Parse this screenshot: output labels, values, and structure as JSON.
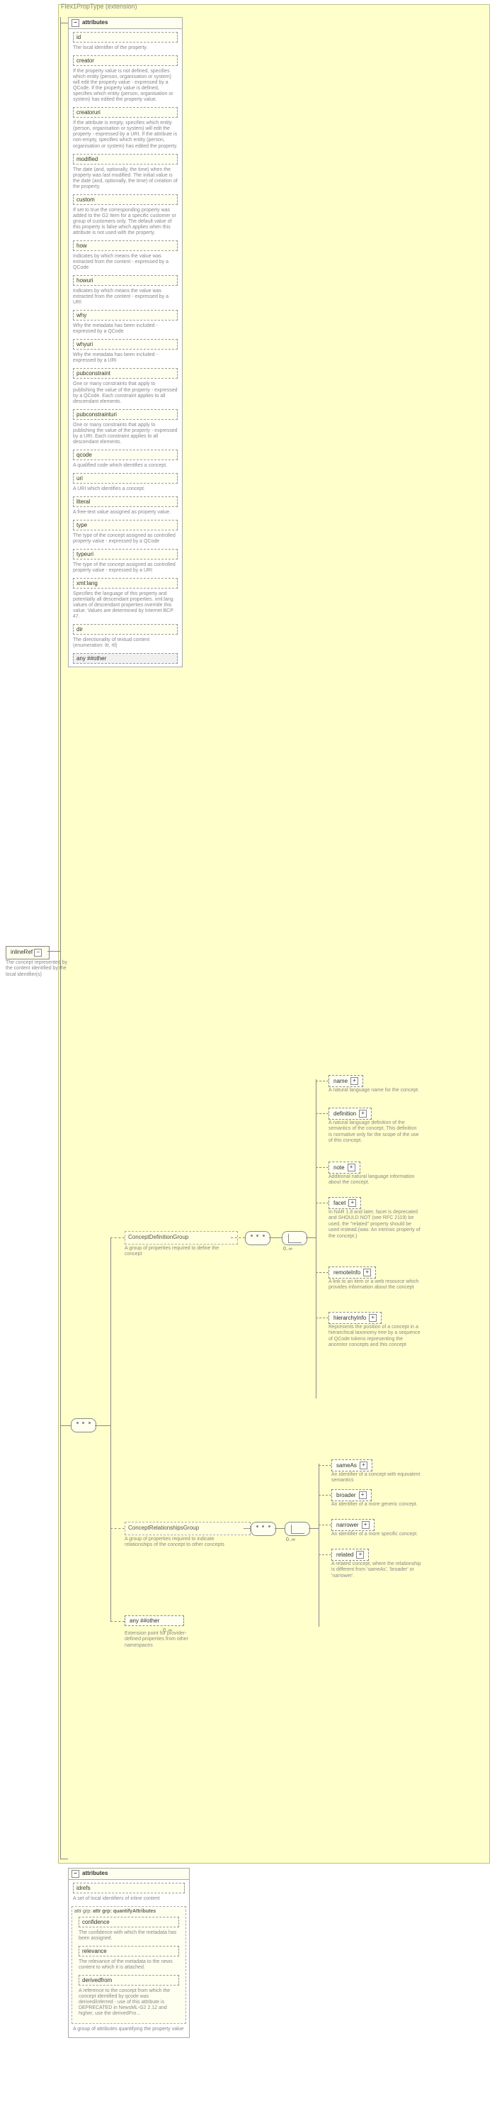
{
  "title": "Flex1PropType (extension)",
  "root": {
    "name": "inlineRef",
    "desc": "The concept represented by the content identified by the local identifier(s)"
  },
  "attr_header": "attributes",
  "attrs1": [
    {
      "n": "id",
      "d": "The local identifier of the property."
    },
    {
      "n": "creator",
      "d": "If the property value is not defined, specifies which entity (person, organisation or system) will edit the property value - expressed by a QCode. If the property value is defined, specifies which entity (person, organisation or system) has edited the property value."
    },
    {
      "n": "creatoruri",
      "d": "If the attribute is empty, specifies which entity (person, organisation or system) will edit the property - expressed by a URI. If the attribute is non-empty, specifies which entity (person, organisation or system) has edited the property."
    },
    {
      "n": "modified",
      "d": "The date (and, optionally, the time) when the property was last modified. The initial value is the date (and, optionally, the time) of creation of the property."
    },
    {
      "n": "custom",
      "d": "If set to true the corresponding property was added to the G2 Item for a specific customer or group of customers only. The default value of this property is false which applies when this attribute is not used with the property."
    },
    {
      "n": "how",
      "d": "Indicates by which means the value was extracted from the content - expressed by a QCode"
    },
    {
      "n": "howuri",
      "d": "Indicates by which means the value was extracted from the content - expressed by a URI"
    },
    {
      "n": "why",
      "d": "Why the metadata has been included - expressed by a QCode"
    },
    {
      "n": "whyuri",
      "d": "Why the metadata has been included - expressed by a URI"
    },
    {
      "n": "pubconstraint",
      "d": "One or many constraints that apply to publishing the value of the property - expressed by a QCode. Each constraint applies to all descendant elements."
    },
    {
      "n": "pubconstrainturi",
      "d": "One or many constraints that apply to publishing the value of the property - expressed by a URI. Each constraint applies to all descendant elements."
    },
    {
      "n": "qcode",
      "d": "A qualified code which identifies a concept."
    },
    {
      "n": "uri",
      "d": "A URI which identifies a concept."
    },
    {
      "n": "literal",
      "d": "A free-text value assigned as property value."
    },
    {
      "n": "type",
      "d": "The type of the concept assigned as controlled property value - expressed by a QCode"
    },
    {
      "n": "typeuri",
      "d": "The type of the concept assigned as controlled property value - expressed by a URI"
    },
    {
      "n": "xml:lang",
      "d": "Specifies the language of this property and potentially all descendant properties. xml:lang values of descendant properties override this value. Values are determined by Internet BCP 47."
    },
    {
      "n": "dir",
      "d": "The directionality of textual content (enumeration: ltr, rtl)"
    }
  ],
  "attrs1_any": "any ##other",
  "cdg": {
    "name": "ConceptDefinitionGroup",
    "d": "A group of properties required to define the concept"
  },
  "crg": {
    "name": "ConceptRelationshipsGroup",
    "d": "A group of properties required to indicate relationships of the concept to other concepts"
  },
  "bottom_any": {
    "label": "any ##other",
    "d": "Extension point for provider-defined properties from other namespaces"
  },
  "cdg_items": [
    {
      "n": "name",
      "d": "A natural language name for the concept."
    },
    {
      "n": "definition",
      "d": "A natural language definition of the semantics of the concept. This definition is normative only for the scope of the use of this concept."
    },
    {
      "n": "note",
      "d": "Additional natural language information about the concept."
    },
    {
      "n": "facet",
      "d": "In NAR 1.8 and later, facet is deprecated and SHOULD NOT (see RFC 2119) be used, the \"related\" property should be used instead.(was: An intrinsic property of the concept.)"
    },
    {
      "n": "remoteInfo",
      "d": "A link to an item or a web resource which provides information about the concept"
    },
    {
      "n": "hierarchyInfo",
      "d": "Represents the position of a concept in a hierarchical taxonomy tree by a sequence of QCode tokens representing the ancestor concepts and this concept"
    }
  ],
  "crg_items": [
    {
      "n": "sameAs",
      "d": "An identifier of a concept with equivalent semantics"
    },
    {
      "n": "broader",
      "d": "An identifier of a more generic concept."
    },
    {
      "n": "narrower",
      "d": "An identifier of a more specific concept."
    },
    {
      "n": "related",
      "d": "A related concept, where the relationship is different from 'sameAs', 'broader' or 'narrower'."
    }
  ],
  "attr2_header": "attributes",
  "idrefs": {
    "n": "idrefs",
    "d": "A set of local identifiers of inline content"
  },
  "qag": {
    "name": "attr grp: quantifyAttributes",
    "d": "A group of attributes quantifying the property value"
  },
  "qag_items": [
    {
      "n": "confidence",
      "d": "The confidence with which the metadata has been assigned."
    },
    {
      "n": "relevance",
      "d": "The relevance of the metadata to the news content to which it is attached."
    },
    {
      "n": "derivedfrom",
      "d": "A reference to the concept from which the concept identified by qcode was derived/inferred - use of this attribute is DEPRECATED in NewsML-G2 2.12 and higher, use the derivedFro..."
    }
  ],
  "card": "0..∞"
}
